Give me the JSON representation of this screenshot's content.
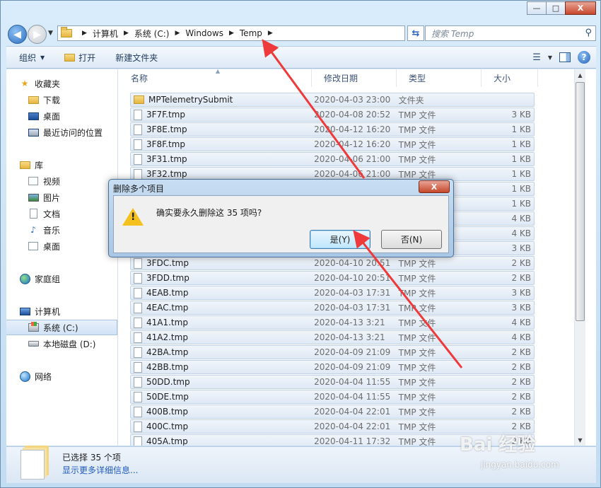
{
  "window": {
    "controls": [
      "—",
      "□",
      "X"
    ]
  },
  "address": {
    "crumbs": [
      "计算机",
      "系统 (C:)",
      "Windows",
      "Temp"
    ],
    "search_placeholder": "搜索 Temp"
  },
  "toolbar": {
    "organize": "组织",
    "open": "打开",
    "new_folder": "新建文件夹"
  },
  "nav": {
    "favorites": "收藏夹",
    "downloads": "下载",
    "desktop": "桌面",
    "recent": "最近访问的位置",
    "libraries": "库",
    "videos": "视频",
    "pictures": "图片",
    "documents": "文档",
    "music": "音乐",
    "lib_desktop": "桌面",
    "homegroup": "家庭组",
    "computer": "计算机",
    "sys_drive": "系统 (C:)",
    "local_disk": "本地磁盘 (D:)",
    "network": "网络"
  },
  "columns": {
    "name": "名称",
    "date": "修改日期",
    "type": "类型",
    "size": "大小"
  },
  "files": [
    {
      "name": "MPTelemetrySubmit",
      "date": "2020-04-03 23:00",
      "type": "文件夹",
      "size": "",
      "folder": true
    },
    {
      "name": "3F7F.tmp",
      "date": "2020-04-08 20:52",
      "type": "TMP 文件",
      "size": "3 KB"
    },
    {
      "name": "3F8E.tmp",
      "date": "2020-04-12 16:20",
      "type": "TMP 文件",
      "size": "1 KB"
    },
    {
      "name": "3F8F.tmp",
      "date": "2020-04-12 16:20",
      "type": "TMP 文件",
      "size": "1 KB"
    },
    {
      "name": "3F31.tmp",
      "date": "2020-04-06 21:00",
      "type": "TMP 文件",
      "size": "1 KB"
    },
    {
      "name": "3F32.tmp",
      "date": "2020-04-06 21:00",
      "type": "TMP 文件",
      "size": "1 KB"
    },
    {
      "name": "",
      "date": "",
      "type": "",
      "size": "1 KB"
    },
    {
      "name": "",
      "date": "",
      "type": "",
      "size": "1 KB"
    },
    {
      "name": "",
      "date": "",
      "type": "",
      "size": "4 KB"
    },
    {
      "name": "",
      "date": "",
      "type": "",
      "size": "4 KB"
    },
    {
      "name": "",
      "date": "",
      "type": "",
      "size": "3 KB"
    },
    {
      "name": "3FDC.tmp",
      "date": "2020-04-10 20:51",
      "type": "TMP 文件",
      "size": "2 KB"
    },
    {
      "name": "3FDD.tmp",
      "date": "2020-04-10 20:51",
      "type": "TMP 文件",
      "size": "2 KB"
    },
    {
      "name": "4EAB.tmp",
      "date": "2020-04-03 17:31",
      "type": "TMP 文件",
      "size": "3 KB"
    },
    {
      "name": "4EAC.tmp",
      "date": "2020-04-03 17:31",
      "type": "TMP 文件",
      "size": "3 KB"
    },
    {
      "name": "41A1.tmp",
      "date": "2020-04-13 3:21",
      "type": "TMP 文件",
      "size": "4 KB"
    },
    {
      "name": "41A2.tmp",
      "date": "2020-04-13 3:21",
      "type": "TMP 文件",
      "size": "4 KB"
    },
    {
      "name": "42BA.tmp",
      "date": "2020-04-09 21:09",
      "type": "TMP 文件",
      "size": "2 KB"
    },
    {
      "name": "42BB.tmp",
      "date": "2020-04-09 21:09",
      "type": "TMP 文件",
      "size": "2 KB"
    },
    {
      "name": "50DD.tmp",
      "date": "2020-04-04 11:55",
      "type": "TMP 文件",
      "size": "2 KB"
    },
    {
      "name": "50DE.tmp",
      "date": "2020-04-04 11:55",
      "type": "TMP 文件",
      "size": "2 KB"
    },
    {
      "name": "400B.tmp",
      "date": "2020-04-04 22:01",
      "type": "TMP 文件",
      "size": "2 KB"
    },
    {
      "name": "400C.tmp",
      "date": "2020-04-04 22:01",
      "type": "TMP 文件",
      "size": "2 KB"
    },
    {
      "name": "405A.tmp",
      "date": "2020-04-11 17:32",
      "type": "TMP 文件",
      "size": "2 KB"
    }
  ],
  "status": {
    "selected": "已选择 35 个项",
    "details_link": "显示更多详细信息..."
  },
  "dialog": {
    "title": "删除多个项目",
    "message": "确实要永久删除这 35 项吗?",
    "yes": "是(Y)",
    "no": "否(N)"
  },
  "watermark": {
    "brand": "Bai 经验",
    "url": "jingyan.baidu.com"
  },
  "colors": {
    "accent": "#1f5bbd",
    "annotation_arrow": "#ee3a3a"
  }
}
